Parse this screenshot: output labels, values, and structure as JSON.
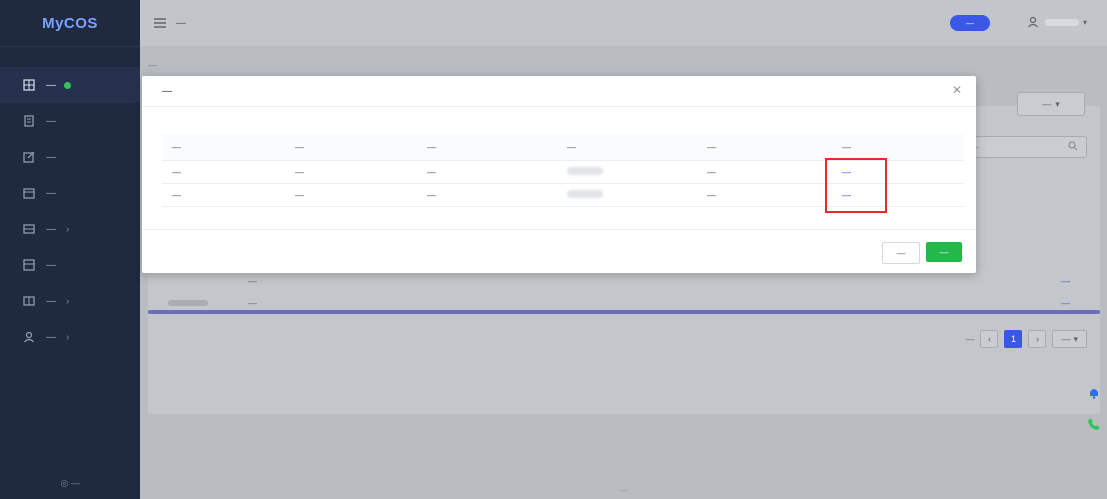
{
  "app": {
    "logo": "MyCOS",
    "title": "—"
  },
  "topbar": {
    "badge": "—",
    "username": "—"
  },
  "sidebar": {
    "items": [
      {
        "label": "—",
        "active": true,
        "has_dot": true,
        "has_chevron": false,
        "icon": "grid-icon"
      },
      {
        "label": "—",
        "active": false,
        "has_dot": false,
        "has_chevron": false,
        "icon": "document-icon"
      },
      {
        "label": "—",
        "active": false,
        "has_dot": false,
        "has_chevron": false,
        "icon": "edit-icon"
      },
      {
        "label": "—",
        "active": false,
        "has_dot": false,
        "has_chevron": false,
        "icon": "calendar-icon"
      },
      {
        "label": "—",
        "active": false,
        "has_dot": false,
        "has_chevron": true,
        "icon": "book-icon"
      },
      {
        "label": "—",
        "active": false,
        "has_dot": false,
        "has_chevron": false,
        "icon": "chart-icon"
      },
      {
        "label": "—",
        "active": false,
        "has_dot": false,
        "has_chevron": true,
        "icon": "database-icon"
      },
      {
        "label": "—",
        "active": false,
        "has_dot": false,
        "has_chevron": true,
        "icon": "user-icon"
      }
    ],
    "footer": "—"
  },
  "content": {
    "breadcrumb": "—",
    "export_label": "—",
    "search_placeholder": "—",
    "bg_rows": [
      {
        "college": "—",
        "actions": "—"
      },
      {
        "college": "—",
        "actions": "—"
      }
    ],
    "pagination": {
      "summary": "—",
      "current": "1",
      "page_size": "—"
    },
    "copyright": "—"
  },
  "modal": {
    "title": "—",
    "columns": [
      "—",
      "—",
      "—",
      "—",
      "—",
      "—"
    ],
    "rows": [
      {
        "course_name": "—",
        "course_type": "—",
        "course_college": "—",
        "teacher_college": "—",
        "action": "—"
      },
      {
        "course_name": "—",
        "course_type": "—",
        "course_college": "—",
        "teacher_college": "—",
        "action": "—"
      }
    ],
    "cancel_label": "—",
    "ok_label": "—"
  },
  "colors": {
    "sidebar_bg": "#1f2a3f",
    "accent_blue": "#3a57e8",
    "link_blue": "#2f4fe0",
    "ok_green": "#23b84a",
    "highlight_red": "#e52b2b",
    "status_dot_green": "#2fc55a"
  }
}
